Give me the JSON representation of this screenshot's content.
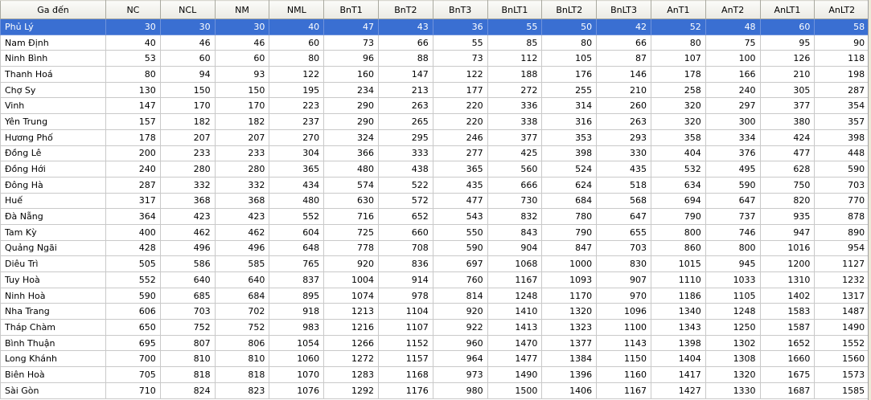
{
  "columns": [
    "Ga đến",
    "NC",
    "NCL",
    "NM",
    "NML",
    "BnT1",
    "BnT2",
    "BnT3",
    "BnLT1",
    "BnLT2",
    "BnLT3",
    "AnT1",
    "AnT2",
    "AnLT1",
    "AnLT2"
  ],
  "rows": [
    {
      "name": "Phủ Lý",
      "values": [
        "30",
        "30",
        "30",
        "40",
        "47",
        "43",
        "36",
        "55",
        "50",
        "42",
        "52",
        "48",
        "60",
        "58"
      ],
      "selected": true
    },
    {
      "name": "Nam Định",
      "values": [
        "40",
        "46",
        "46",
        "60",
        "73",
        "66",
        "55",
        "85",
        "80",
        "66",
        "80",
        "75",
        "95",
        "90"
      ]
    },
    {
      "name": "Ninh Bình",
      "values": [
        "53",
        "60",
        "60",
        "80",
        "96",
        "88",
        "73",
        "112",
        "105",
        "87",
        "107",
        "100",
        "126",
        "118"
      ]
    },
    {
      "name": "Thanh Hoá",
      "values": [
        "80",
        "94",
        "93",
        "122",
        "160",
        "147",
        "122",
        "188",
        "176",
        "146",
        "178",
        "166",
        "210",
        "198"
      ]
    },
    {
      "name": "Chợ Sy",
      "values": [
        "130",
        "150",
        "150",
        "195",
        "234",
        "213",
        "177",
        "272",
        "255",
        "210",
        "258",
        "240",
        "305",
        "287"
      ]
    },
    {
      "name": "Vinh",
      "values": [
        "147",
        "170",
        "170",
        "223",
        "290",
        "263",
        "220",
        "336",
        "314",
        "260",
        "320",
        "297",
        "377",
        "354"
      ]
    },
    {
      "name": "Yên Trung",
      "values": [
        "157",
        "182",
        "182",
        "237",
        "290",
        "265",
        "220",
        "338",
        "316",
        "263",
        "320",
        "300",
        "380",
        "357"
      ]
    },
    {
      "name": "Hương Phố",
      "values": [
        "178",
        "207",
        "207",
        "270",
        "324",
        "295",
        "246",
        "377",
        "353",
        "293",
        "358",
        "334",
        "424",
        "398"
      ]
    },
    {
      "name": "Đồng Lê",
      "values": [
        "200",
        "233",
        "233",
        "304",
        "366",
        "333",
        "277",
        "425",
        "398",
        "330",
        "404",
        "376",
        "477",
        "448"
      ]
    },
    {
      "name": "Đồng Hới",
      "values": [
        "240",
        "280",
        "280",
        "365",
        "480",
        "438",
        "365",
        "560",
        "524",
        "435",
        "532",
        "495",
        "628",
        "590"
      ]
    },
    {
      "name": "Đông Hà",
      "values": [
        "287",
        "332",
        "332",
        "434",
        "574",
        "522",
        "435",
        "666",
        "624",
        "518",
        "634",
        "590",
        "750",
        "703"
      ]
    },
    {
      "name": "Huế",
      "values": [
        "317",
        "368",
        "368",
        "480",
        "630",
        "572",
        "477",
        "730",
        "684",
        "568",
        "694",
        "647",
        "820",
        "770"
      ]
    },
    {
      "name": "Đà Nẵng",
      "values": [
        "364",
        "423",
        "423",
        "552",
        "716",
        "652",
        "543",
        "832",
        "780",
        "647",
        "790",
        "737",
        "935",
        "878"
      ]
    },
    {
      "name": "Tam Kỳ",
      "values": [
        "400",
        "462",
        "462",
        "604",
        "725",
        "660",
        "550",
        "843",
        "790",
        "655",
        "800",
        "746",
        "947",
        "890"
      ]
    },
    {
      "name": "Quảng Ngãi",
      "values": [
        "428",
        "496",
        "496",
        "648",
        "778",
        "708",
        "590",
        "904",
        "847",
        "703",
        "860",
        "800",
        "1016",
        "954"
      ]
    },
    {
      "name": "Diêu Trì",
      "values": [
        "505",
        "586",
        "585",
        "765",
        "920",
        "836",
        "697",
        "1068",
        "1000",
        "830",
        "1015",
        "945",
        "1200",
        "1127"
      ]
    },
    {
      "name": "Tuy Hoà",
      "values": [
        "552",
        "640",
        "640",
        "837",
        "1004",
        "914",
        "760",
        "1167",
        "1093",
        "907",
        "1110",
        "1033",
        "1310",
        "1232"
      ]
    },
    {
      "name": "Ninh Hoà",
      "values": [
        "590",
        "685",
        "684",
        "895",
        "1074",
        "978",
        "814",
        "1248",
        "1170",
        "970",
        "1186",
        "1105",
        "1402",
        "1317"
      ]
    },
    {
      "name": "Nha Trang",
      "values": [
        "606",
        "703",
        "702",
        "918",
        "1213",
        "1104",
        "920",
        "1410",
        "1320",
        "1096",
        "1340",
        "1248",
        "1583",
        "1487"
      ]
    },
    {
      "name": "Tháp Chàm",
      "values": [
        "650",
        "752",
        "752",
        "983",
        "1216",
        "1107",
        "922",
        "1413",
        "1323",
        "1100",
        "1343",
        "1250",
        "1587",
        "1490"
      ]
    },
    {
      "name": "Bình Thuận",
      "values": [
        "695",
        "807",
        "806",
        "1054",
        "1266",
        "1152",
        "960",
        "1470",
        "1377",
        "1143",
        "1398",
        "1302",
        "1652",
        "1552"
      ]
    },
    {
      "name": "Long Khánh",
      "values": [
        "700",
        "810",
        "810",
        "1060",
        "1272",
        "1157",
        "964",
        "1477",
        "1384",
        "1150",
        "1404",
        "1308",
        "1660",
        "1560"
      ]
    },
    {
      "name": "Biên Hoà",
      "values": [
        "705",
        "818",
        "818",
        "1070",
        "1283",
        "1168",
        "973",
        "1490",
        "1396",
        "1160",
        "1417",
        "1320",
        "1675",
        "1573"
      ]
    },
    {
      "name": "Sài Gòn",
      "values": [
        "710",
        "824",
        "823",
        "1076",
        "1292",
        "1176",
        "980",
        "1500",
        "1406",
        "1167",
        "1427",
        "1330",
        "1687",
        "1585"
      ]
    }
  ]
}
